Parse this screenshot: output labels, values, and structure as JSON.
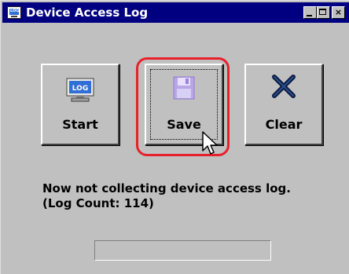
{
  "window": {
    "title": "Device Access Log",
    "app_icon_text": "LOG"
  },
  "buttons": {
    "start": {
      "label": "Start",
      "icon": "log-monitor-icon"
    },
    "save": {
      "label": "Save",
      "icon": "floppy-disk-icon"
    },
    "clear": {
      "label": "Clear",
      "icon": "x-mark-icon"
    }
  },
  "status": {
    "line1": "Now not collecting device access log.",
    "line2": "(Log Count: 114)"
  },
  "progress": {
    "value": 0
  },
  "colors": {
    "title_bar": "#000080",
    "window_bg": "#c0c0c0",
    "highlight": "#e8202c"
  }
}
